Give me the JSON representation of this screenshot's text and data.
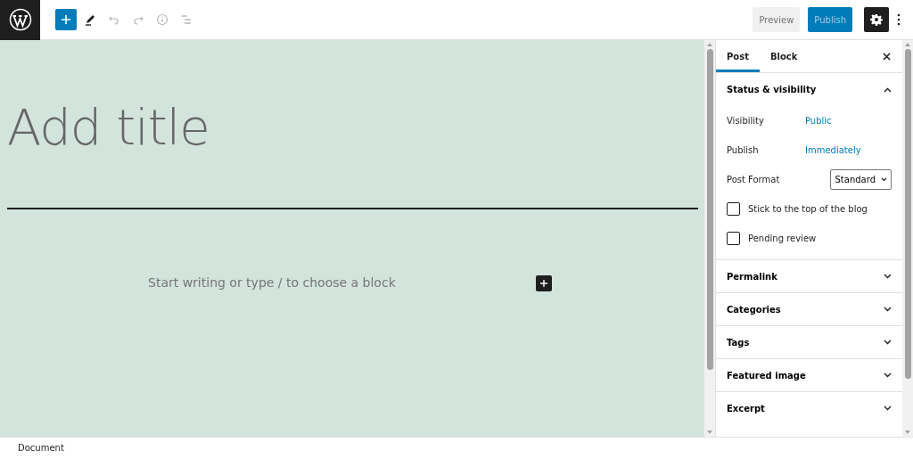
{
  "toolbar": {
    "tools": [
      {
        "kind": "inserter",
        "disabled": false
      },
      {
        "kind": "edit",
        "disabled": false
      },
      {
        "kind": "undo",
        "disabled": true
      },
      {
        "kind": "redo",
        "disabled": true
      },
      {
        "kind": "info",
        "disabled": true
      },
      {
        "kind": "outline",
        "disabled": true
      }
    ],
    "preview_button": {
      "label": "Preview",
      "disabled": true
    },
    "publish_button": {
      "label": "Publish",
      "disabled": true
    },
    "settings_button": {
      "selected": true
    }
  },
  "editor": {
    "title_placeholder": "Add title",
    "body_placeholder": "Start writing or type / to choose a block"
  },
  "sidebar": {
    "tabs": [
      {
        "label": "Post",
        "selected": true
      },
      {
        "label": "Block",
        "selected": false
      }
    ],
    "panels": [
      {
        "title": "Status & visibility",
        "expanded": true,
        "rows": [
          {
            "kind": "link",
            "label": "Visibility",
            "value": "Public"
          },
          {
            "kind": "link",
            "label": "Publish",
            "value": "Immediately"
          },
          {
            "kind": "select",
            "label": "Post Format",
            "value": "Standard"
          },
          {
            "kind": "checkbox",
            "label": "Stick to the top of the blog",
            "checked": false
          },
          {
            "kind": "checkbox",
            "label": "Pending review",
            "checked": false
          }
        ]
      },
      {
        "title": "Permalink",
        "expanded": false
      },
      {
        "title": "Categories",
        "expanded": false
      },
      {
        "title": "Tags",
        "expanded": false
      },
      {
        "title": "Featured image",
        "expanded": false
      },
      {
        "title": "Excerpt",
        "expanded": false
      }
    ]
  },
  "footer": {
    "breadcrumb": "Document"
  }
}
